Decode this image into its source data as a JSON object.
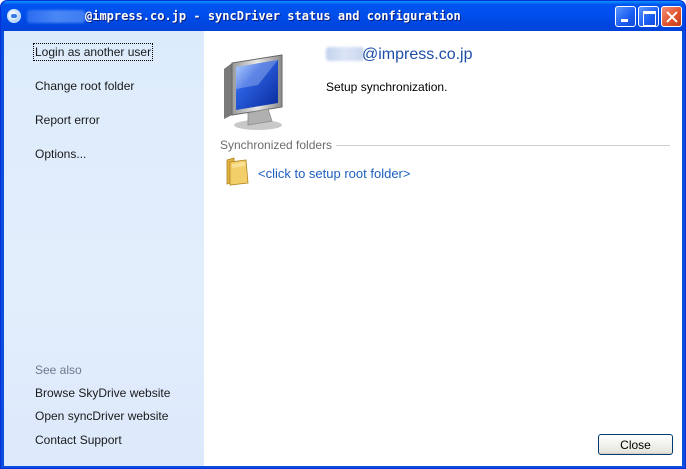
{
  "window": {
    "title_suffix": "@impress.co.jp - syncDriver status and configuration"
  },
  "sidebar": {
    "items": [
      {
        "label": "Login as another user"
      },
      {
        "label": "Change root folder"
      },
      {
        "label": "Report error"
      },
      {
        "label": "Options..."
      }
    ],
    "see_also_heading": "See also",
    "see_also": [
      {
        "label": "Browse SkyDrive website"
      },
      {
        "label": "Open syncDriver website"
      },
      {
        "label": "Contact Support"
      }
    ]
  },
  "main": {
    "user_email_suffix": "@impress.co.jp",
    "status": "Setup synchronization.",
    "synced_label": "Synchronized folders",
    "setup_link": "<click to setup root folder>",
    "close_label": "Close"
  },
  "colors": {
    "titlebar": "#0053ee",
    "sidebar_bg": "#dfecfc",
    "link_blue": "#1d5fc0",
    "email_blue": "#1d4ea8"
  },
  "icons": {
    "title": "skydrive-cloud-icon",
    "monitor": "monitor-icon",
    "folder": "folder-icon"
  }
}
